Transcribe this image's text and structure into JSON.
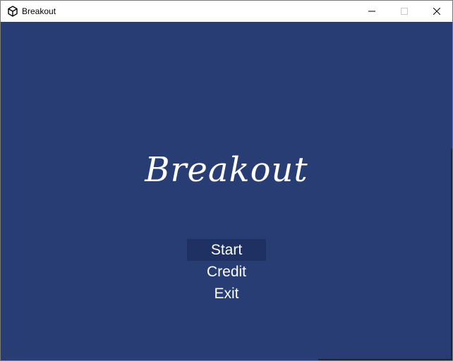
{
  "window": {
    "title": "Breakout",
    "icon": "unity-logo-icon"
  },
  "controls": {
    "minimize": "minimize-icon",
    "maximize": "maximize-icon",
    "close": "close-icon"
  },
  "game": {
    "title": "Breakout",
    "background_color": "#283d73",
    "menu": [
      {
        "label": "Start",
        "selected": true
      },
      {
        "label": "Credit",
        "selected": false
      },
      {
        "label": "Exit",
        "selected": false
      }
    ]
  }
}
